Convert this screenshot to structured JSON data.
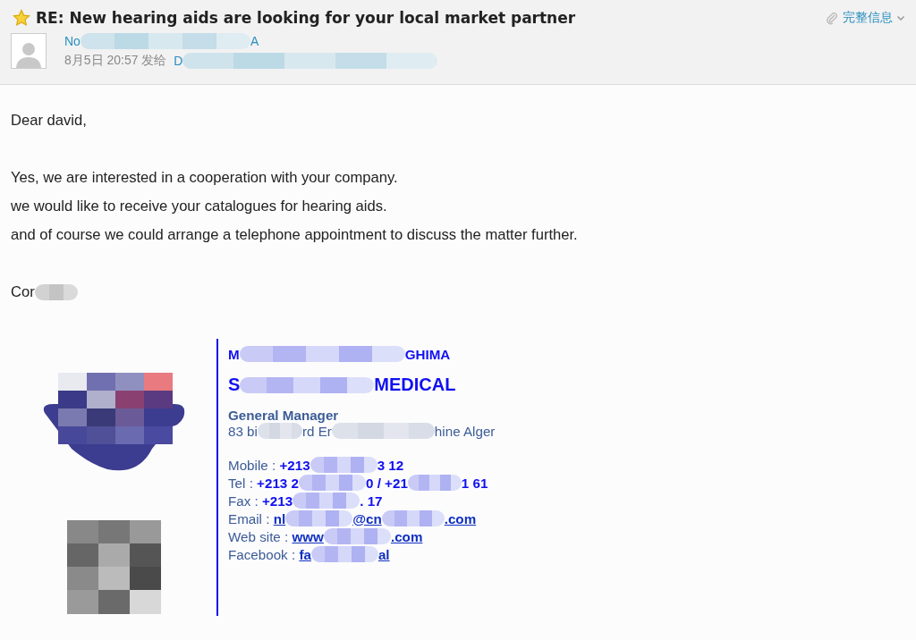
{
  "header": {
    "starred": true,
    "subject": "RE: New hearing aids are looking for your local market partner",
    "details_link": "完整信息",
    "sender": [
      "No",
      "A"
    ],
    "date": "8月5日 20:57",
    "sent_to": "发给",
    "recipient": [
      "D"
    ]
  },
  "body": {
    "greeting": "Dear david,",
    "paragraphs": [
      "Yes, we are interested in a cooperation with your company.",
      "we would like to receive your catalogues for hearing aids.",
      "and of course we could arrange a telephone appointment to discuss the matter further."
    ],
    "closing": [
      "Cor"
    ]
  },
  "signature": {
    "name": [
      "M",
      "GHIMA"
    ],
    "company": [
      "S",
      "MEDICAL"
    ],
    "title": "General Manager",
    "address": [
      "83 bi",
      "rd Er",
      "hine Alger"
    ],
    "contacts": [
      {
        "label": "Mobile :",
        "kind": "text",
        "value": [
          "+213",
          "3 12"
        ]
      },
      {
        "label": "Tel :",
        "kind": "text",
        "value": [
          "+213 2",
          "0 / +21",
          "1 61"
        ]
      },
      {
        "label": "Fax :",
        "kind": "text",
        "value": [
          "+213",
          ". 17"
        ]
      },
      {
        "label": "Email :",
        "kind": "link",
        "value": [
          "nl",
          "@cn",
          ".com"
        ]
      },
      {
        "label": "Web site :",
        "kind": "link",
        "value": [
          "www",
          ".com"
        ]
      },
      {
        "label": "Facebook :",
        "kind": "link",
        "value": [
          "fa",
          "al"
        ]
      }
    ]
  }
}
